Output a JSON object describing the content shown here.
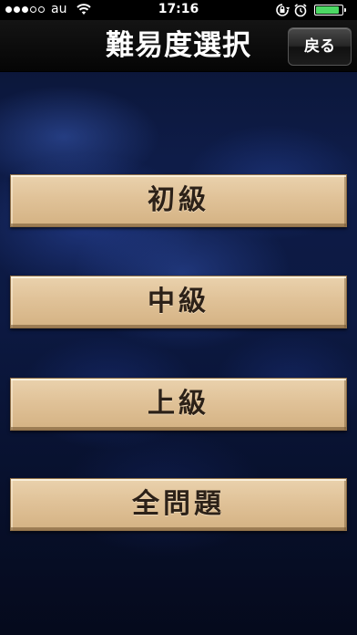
{
  "status_bar": {
    "carrier": "au",
    "time": "17:16",
    "signal_bars_filled": 3,
    "signal_bars_total": 5,
    "battery_level": 0.88,
    "icons": [
      "signal-dots-icon",
      "wifi-icon",
      "rotation-lock-icon",
      "alarm-icon",
      "battery-icon"
    ]
  },
  "nav": {
    "title": "難易度選択",
    "back_label": "戻る"
  },
  "levels": {
    "beginner": "初級",
    "intermediate": "中級",
    "advanced": "上級",
    "all": "全問題"
  },
  "colors": {
    "button_face": "#e0c298",
    "button_text": "#2c2118",
    "background": "#0c1942",
    "battery_fill": "#4cd964"
  }
}
